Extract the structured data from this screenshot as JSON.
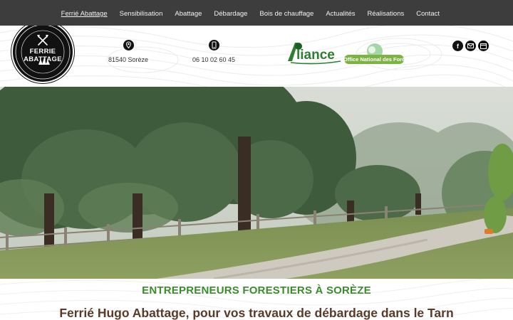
{
  "nav": {
    "items": [
      {
        "label": "Ferrié Abattage",
        "active": true
      },
      {
        "label": "Sensibilisation"
      },
      {
        "label": "Abattage"
      },
      {
        "label": "Débardage"
      },
      {
        "label": "Bois de chauffage"
      },
      {
        "label": "Actualités"
      },
      {
        "label": "Réalisations"
      },
      {
        "label": "Contact"
      }
    ]
  },
  "header": {
    "logo_text": "FERRIE ABATTAGE",
    "address": "81540 Sorèze",
    "phone": "06 10 02 60 45",
    "partner1_name": "Alliance",
    "partner2_name": "Office National des Forêts",
    "social_icons": [
      "facebook-icon",
      "email-icon",
      "calendar-icon"
    ]
  },
  "hero": {
    "image": "forest-road-photo"
  },
  "main": {
    "subtitle": "ENTREPRENEURS FORESTIERS À SORÈZE",
    "headline": "Ferrié Hugo Abattage, pour vos travaux de débardage dans le Tarn"
  },
  "colors": {
    "nav_bg": "#3d3d3d",
    "green": "#3a8c2b",
    "brown": "#5a3a28"
  }
}
